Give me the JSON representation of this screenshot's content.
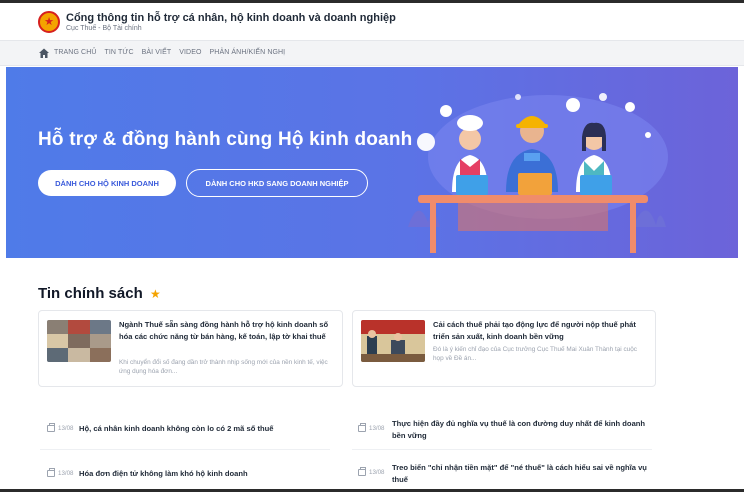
{
  "header": {
    "site_title": "Cổng thông tin hỗ trợ cá nhân, hộ kinh doanh và doanh nghiệp",
    "site_subtitle": "Cục Thuế - Bộ Tài chính"
  },
  "nav": {
    "items": [
      "TRANG CHỦ",
      "TIN TỨC",
      "BÀI VIẾT",
      "VIDEO",
      "PHẢN ÁNH/KIẾN NGHỊ"
    ]
  },
  "hero": {
    "title": "Hỗ trợ & đồng hành cùng Hộ kinh doanh",
    "button_primary": "DÀNH CHO HỘ KINH DOANH",
    "button_secondary": "DÀNH CHO HKD SANG DOANH NGHIỆP"
  },
  "section": {
    "title": "Tin chính sách"
  },
  "cards": [
    {
      "title": "Ngành Thuế sẵn sàng đồng hành hỗ trợ hộ kinh doanh số hóa các chức năng từ bán hàng, kế toán, lập tờ khai thuế",
      "desc": "Khi chuyển đổi số đang dần trở thành nhịp sống mới của nền kinh tế, việc ứng dụng hóa đơn..."
    },
    {
      "title": "Cải cách thuế phải tạo động lực để người nộp thuế phát triển sản xuất, kinh doanh bền vững",
      "desc": "Đó là ý kiến chỉ đạo của Cục trưởng Cục Thuế Mai Xuân Thành tại cuộc họp về Đề án..."
    }
  ],
  "news": [
    {
      "date": "13/08",
      "title": "Hộ, cá nhân kinh doanh không còn lo có 2 mã số thuế"
    },
    {
      "date": "13/08",
      "title": "Thực hiện đầy đủ nghĩa vụ thuế là con đường duy nhất để kinh doanh bền vững"
    },
    {
      "date": "13/08",
      "title": "Hóa đơn điện tử không làm khó hộ kinh doanh"
    },
    {
      "date": "13/08",
      "title": "Treo biển \"chỉ nhận tiền mặt\" để \"né thuế\" là cách hiểu sai về nghĩa vụ thuế"
    }
  ],
  "colors": {
    "hero_start": "#4f7be8",
    "hero_end": "#6c63d9",
    "accent": "#f4a300",
    "brand_red": "#d6201e"
  }
}
